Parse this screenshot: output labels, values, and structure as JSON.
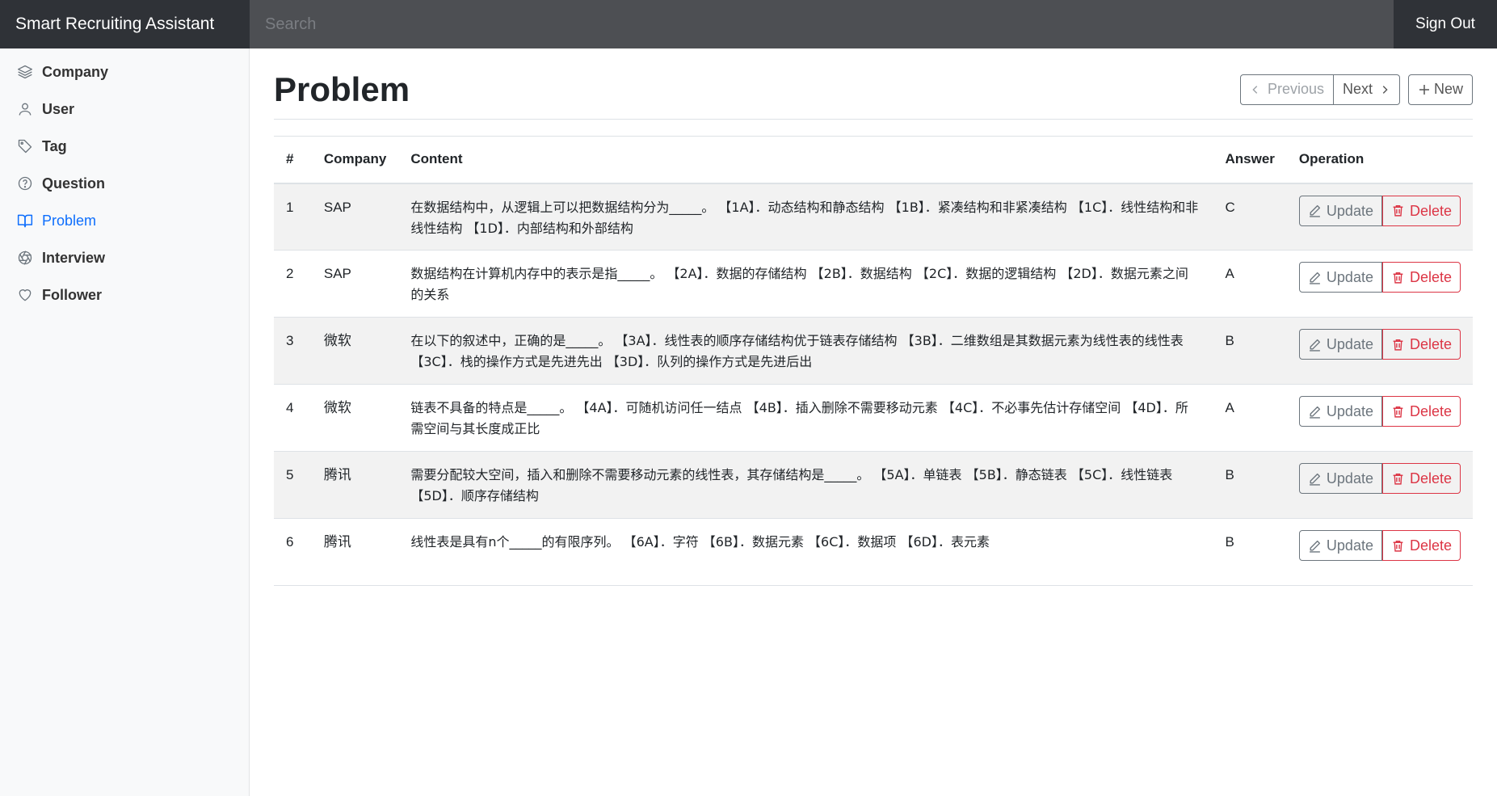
{
  "app": {
    "title": "Smart Recruiting Assistant",
    "sign_out": "Sign Out"
  },
  "search": {
    "placeholder": "Search"
  },
  "sidebar": {
    "items": [
      {
        "label": "Company",
        "icon": "layers-icon",
        "active": false
      },
      {
        "label": "User",
        "icon": "user-icon",
        "active": false
      },
      {
        "label": "Tag",
        "icon": "tag-icon",
        "active": false
      },
      {
        "label": "Question",
        "icon": "question-circle-icon",
        "active": false
      },
      {
        "label": "Problem",
        "icon": "book-open-icon",
        "active": true
      },
      {
        "label": "Interview",
        "icon": "aperture-icon",
        "active": false
      },
      {
        "label": "Follower",
        "icon": "heart-icon",
        "active": false
      }
    ]
  },
  "page": {
    "title": "Problem",
    "previous_label": "Previous",
    "next_label": "Next",
    "new_label": "New"
  },
  "table": {
    "headers": [
      "#",
      "Company",
      "Content",
      "Answer",
      "Operation"
    ],
    "update_label": "Update",
    "delete_label": "Delete",
    "rows": [
      {
        "num": "1",
        "company": "SAP",
        "content": "在数据结构中，从逻辑上可以把数据结构分为_____。 【1A】．动态结构和静态结构 【1B】．紧凑结构和非紧凑结构 【1C】．线性结构和非线性结构 【1D】．内部结构和外部结构",
        "answer": "C"
      },
      {
        "num": "2",
        "company": "SAP",
        "content": "数据结构在计算机内存中的表示是指_____。 【2A】．数据的存储结构 【2B】．数据结构 【2C】．数据的逻辑结构 【2D】．数据元素之间的关系",
        "answer": "A"
      },
      {
        "num": "3",
        "company": "微软",
        "content": "在以下的叙述中，正确的是_____。 【3A】．线性表的顺序存储结构优于链表存储结构 【3B】．二维数组是其数据元素为线性表的线性表 【3C】．栈的操作方式是先进先出 【3D】．队列的操作方式是先进后出",
        "answer": "B"
      },
      {
        "num": "4",
        "company": "微软",
        "content": "链表不具备的特点是_____。 【4A】．可随机访问任一结点 【4B】．插入删除不需要移动元素 【4C】．不必事先估计存储空间 【4D】．所需空间与其长度成正比",
        "answer": "A"
      },
      {
        "num": "5",
        "company": "腾讯",
        "content": "需要分配较大空间，插入和删除不需要移动元素的线性表，其存储结构是_____。 【5A】．单链表 【5B】．静态链表 【5C】．线性链表 【5D】．顺序存储结构",
        "answer": "B"
      },
      {
        "num": "6",
        "company": "腾讯",
        "content": "线性表是具有n个_____的有限序列。 【6A】．字符 【6B】．数据元素 【6C】．数据项 【6D】．表元素",
        "answer": "B"
      }
    ]
  }
}
